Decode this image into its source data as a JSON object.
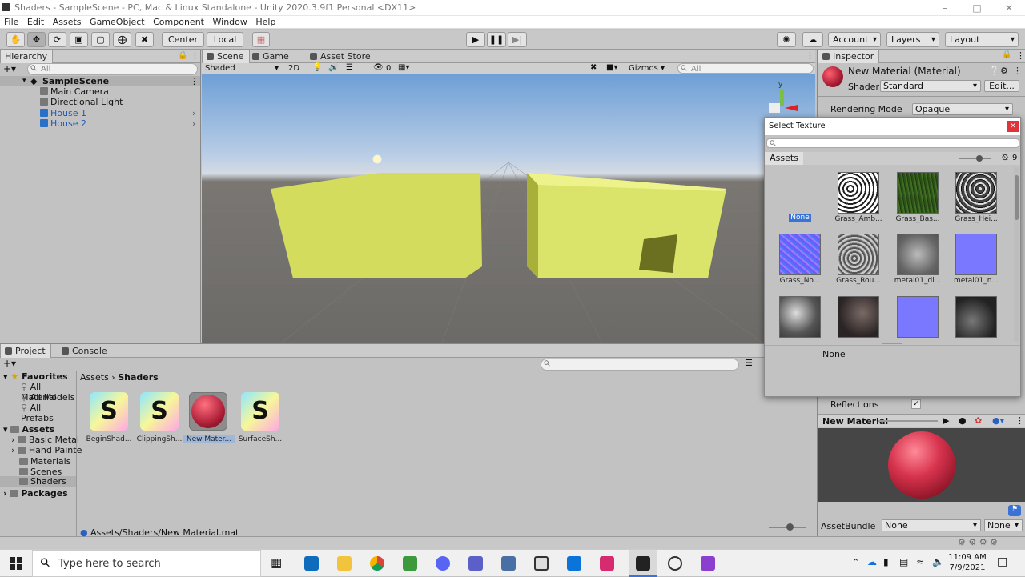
{
  "window": {
    "title": "Shaders - SampleScene - PC, Mac & Linux Standalone - Unity 2020.3.9f1 Personal <DX11>"
  },
  "menu": [
    "File",
    "Edit",
    "Assets",
    "GameObject",
    "Component",
    "Window",
    "Help"
  ],
  "toolbar": {
    "pivot": "Center",
    "space": "Local",
    "account": "Account",
    "layers": "Layers",
    "layout": "Layout"
  },
  "hierarchy": {
    "tab": "Hierarchy",
    "search_placeholder": "All",
    "scene": "SampleScene",
    "items": [
      "Main Camera",
      "Directional Light",
      "House 1",
      "House 2"
    ]
  },
  "scene": {
    "tabs": [
      "Scene",
      "Game",
      "Asset Store"
    ],
    "shading": "Shaded",
    "mode2d": "2D",
    "hidden_count": "0",
    "gizmos": "Gizmos",
    "search_placeholder": "All",
    "gizmo_axis": "y"
  },
  "inspector": {
    "tab": "Inspector",
    "material_name": "New Material (Material)",
    "shader_label": "Shader",
    "shader_value": "Standard",
    "edit": "Edit...",
    "rendering_mode_label": "Rendering Mode",
    "rendering_mode_value": "Opaque",
    "reflections_label": "Reflections",
    "preview_title": "New Material",
    "assetbundle_label": "AssetBundle",
    "assetbundle_value": "None",
    "assetbundle_variant": "None"
  },
  "select_texture": {
    "title": "Select Texture",
    "tab": "Assets",
    "count": "9",
    "none_label": "None",
    "footer": "None",
    "items": [
      "Grass_Amb...",
      "Grass_Bas...",
      "Grass_Hei...",
      "Grass_No...",
      "Grass_Rou...",
      "metal01_di...",
      "metal01_n..."
    ]
  },
  "project": {
    "tabs": [
      "Project",
      "Console"
    ],
    "favorites": "Favorites",
    "fav_items": [
      "All Material",
      "All Models",
      "All Prefabs"
    ],
    "assets": "Assets",
    "asset_folders": [
      "Basic Metal",
      "Hand Painte",
      "Materials",
      "Scenes",
      "Shaders"
    ],
    "packages": "Packages",
    "breadcrumb": [
      "Assets",
      "Shaders"
    ],
    "files": [
      "BeginShad...",
      "ClippingSh...",
      "New Mater...",
      "SurfaceSh..."
    ],
    "status_path": "Assets/Shaders/New Material.mat"
  },
  "taskbar": {
    "search_placeholder": "Type here to search",
    "time": "11:09 AM",
    "date": "7/9/2021"
  },
  "colors": {
    "accent": "#3a72d6",
    "material": "#c43a52",
    "selected": "#3a72d6"
  }
}
